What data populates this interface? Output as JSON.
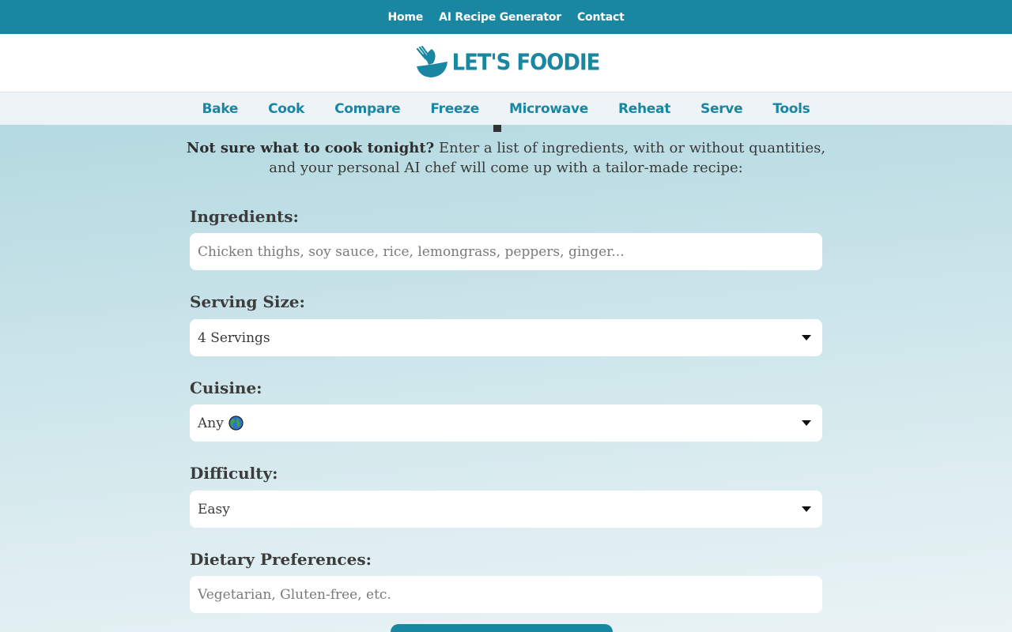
{
  "topnav": {
    "items": [
      "Home",
      "AI Recipe Generator",
      "Contact"
    ]
  },
  "logo": {
    "text": "LET'S FOODIE"
  },
  "categories": [
    "Bake",
    "Cook",
    "Compare",
    "Freeze",
    "Microwave",
    "Reheat",
    "Serve",
    "Tools"
  ],
  "intro": {
    "bold": "Not sure what to cook tonight?",
    "line1": " Enter a list of ingredients, with or without quantities,",
    "line2": "and your personal AI chef will come up with a tailor-made recipe:"
  },
  "form": {
    "ingredients": {
      "label": "Ingredients:",
      "placeholder": "Chicken thighs, soy sauce, rice, lemongrass, peppers, ginger..."
    },
    "serving": {
      "label": "Serving Size:",
      "value": "4 Servings"
    },
    "cuisine": {
      "label": "Cuisine:",
      "value": "Any",
      "icon": "globe-icon"
    },
    "difficulty": {
      "label": "Difficulty:",
      "value": "Easy"
    },
    "dietary": {
      "label": "Dietary Preferences:",
      "placeholder": "Vegetarian, Gluten-free, etc."
    }
  },
  "colors": {
    "brand": "#1a87a2",
    "catnav_bg": "#edf3f6"
  }
}
